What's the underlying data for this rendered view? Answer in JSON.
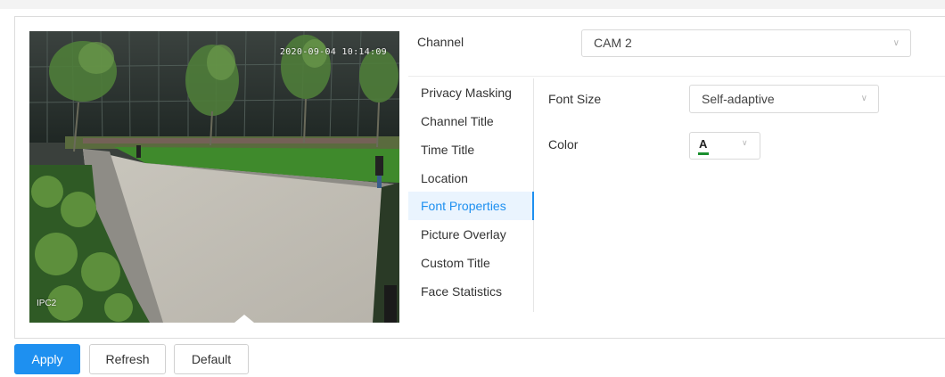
{
  "video": {
    "timestamp": "2020-09-04 10:14:09",
    "channel_osd": "IPC2"
  },
  "channel": {
    "label": "Channel",
    "selected": "CAM 2"
  },
  "menu": {
    "items": [
      {
        "label": "Privacy Masking"
      },
      {
        "label": "Channel Title"
      },
      {
        "label": "Time Title"
      },
      {
        "label": "Location"
      },
      {
        "label": "Font Properties"
      },
      {
        "label": "Picture Overlay"
      },
      {
        "label": "Custom Title"
      },
      {
        "label": "Face Statistics"
      }
    ],
    "active": "Font Properties"
  },
  "form": {
    "font_size_label": "Font Size",
    "font_size_value": "Self-adaptive",
    "color_label": "Color",
    "color_letter": "A",
    "color_value": "#1a8f2e"
  },
  "buttons": {
    "apply": "Apply",
    "refresh": "Refresh",
    "default": "Default"
  },
  "theme": {
    "accent": "#1e90f0"
  }
}
